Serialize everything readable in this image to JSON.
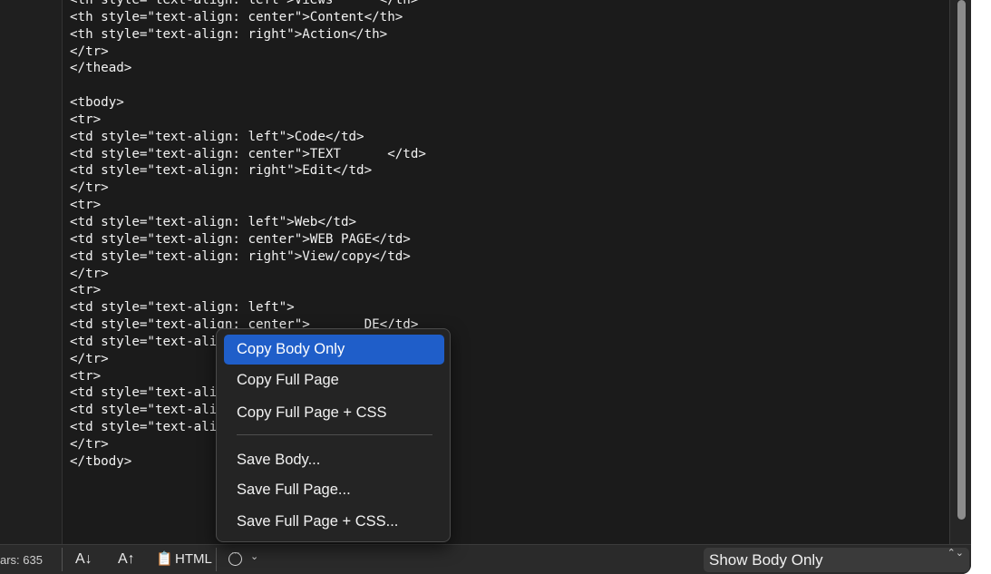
{
  "editor": {
    "lines": [
      "<th style=\"text-align: left\">Views      </th>",
      "<th style=\"text-align: center\">Content</th>",
      "<th style=\"text-align: right\">Action</th>",
      "</tr>",
      "</thead>",
      "",
      "<tbody>",
      "<tr>",
      "<td style=\"text-align: left\">Code</td>",
      "<td style=\"text-align: center\">TEXT      </td>",
      "<td style=\"text-align: right\">Edit</td>",
      "</tr>",
      "<tr>",
      "<td style=\"text-align: left\">Web</td>",
      "<td style=\"text-align: center\">WEB PAGE</td>",
      "<td style=\"text-align: right\">View/copy</td>",
      "</tr>",
      "<tr>",
      "<td style=\"text-align: left\">",
      "<td style=\"text-align: center\">       DE</td>",
      "<td style=\"text-align: right\">       l>",
      "</tr>",
      "<tr>",
      "<td style=\"text-align: left\">      .",
      "<td style=\"text-align: center\">      DDE</td>",
      "<td style=\"text-align: right\">       l>",
      "</tr>",
      "</tbody>"
    ]
  },
  "statusbar": {
    "chars": "ars: 635",
    "sort_ascending": "A↓",
    "sort_descending": "A↑",
    "clipboard_icon": "📋",
    "mode_label": "HTML",
    "more_icon": "···",
    "chevron": "⌄",
    "view_select": "Show Body Only",
    "select_arrows": "⌃⌄"
  },
  "menu": {
    "items": [
      {
        "label": "Copy Body Only",
        "selected": true
      },
      {
        "label": "Copy Full Page"
      },
      {
        "label": "Copy Full Page + CSS"
      },
      {
        "label": "Save Body..."
      },
      {
        "label": "Save Full Page..."
      },
      {
        "label": "Save Full Page + CSS..."
      }
    ]
  },
  "colors": {
    "accent": "#1f5ec9",
    "background": "#1b1b1b",
    "text": "#f2f2f2"
  }
}
